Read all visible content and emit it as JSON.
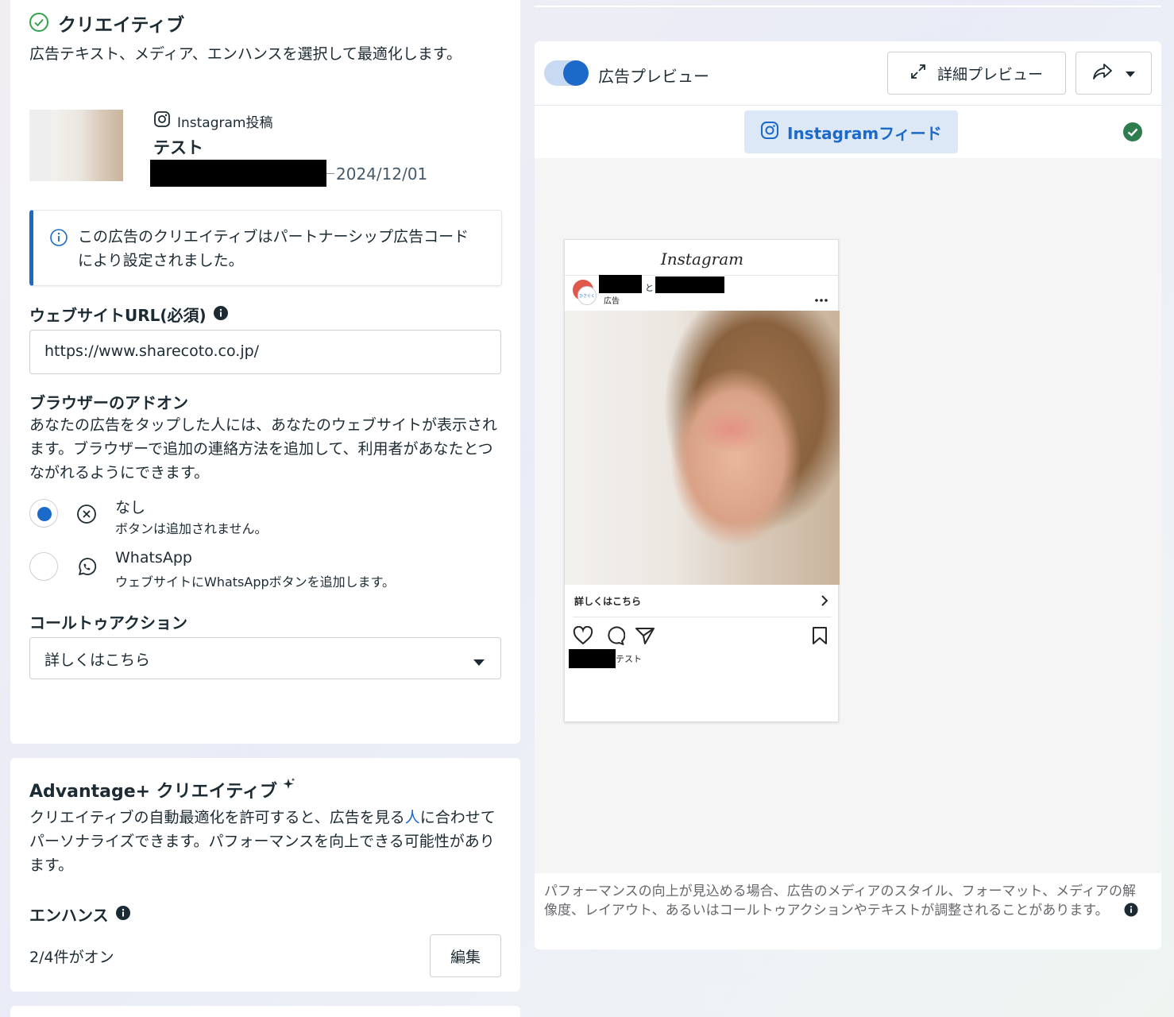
{
  "creative": {
    "title": "クリエイティブ",
    "description": "広告テキスト、メディア、エンハンスを選択して最適化します。",
    "post": {
      "platform_label": "Instagram投稿",
      "name": "テスト",
      "date": "2024/12/01"
    },
    "info_message": "この広告のクリエイティブはパートナーシップ広告コードにより設定されました。",
    "website_url": {
      "label": "ウェブサイトURL(必須)",
      "value": "https://www.sharecoto.co.jp/"
    },
    "browser_addon": {
      "title": "ブラウザーのアドオン",
      "description": "あなたの広告をタップした人には、あなたのウェブサイトが表示されます。ブラウザーで追加の連絡方法を追加して、利用者があなたとつながれるようにできます。",
      "options": [
        {
          "title": "なし",
          "subtitle": "ボタンは追加されません。",
          "selected": true,
          "icon": "x-circle-icon"
        },
        {
          "title": "WhatsApp",
          "subtitle": "ウェブサイトにWhatsAppボタンを追加します。",
          "selected": false,
          "icon": "whatsapp-icon"
        }
      ]
    },
    "cta": {
      "label": "コールトゥアクション",
      "value": "詳しくはこちら"
    }
  },
  "advantage": {
    "title": "Advantage+ クリエイティブ",
    "description_before": "クリエイティブの自動最適化を許可すると、広告を見る",
    "description_link": "人",
    "description_after": "に合わせてパーソナライズできます。パフォーマンスを向上できる可能性があります。",
    "enhance_label": "エンハンス",
    "enhance_status": "2/4件がオン",
    "edit_button": "編集"
  },
  "preview": {
    "toggle_label": "広告プレビュー",
    "toggle_on": true,
    "detail_button": "詳細プレビュー",
    "placement_tab": "Instagramフィード",
    "ig": {
      "logo": "Instagram",
      "conj": "と",
      "sponsored": "広告",
      "avatar_text": "ひさぐく",
      "cta": "詳しくはこちら",
      "caption": "テスト"
    },
    "footnote": "パフォーマンスの向上が見込める場合、広告のメディアのスタイル、フォーマット、メディアの解像度、レイアウト、あるいはコールトゥアクションやテキストが調整されることがあります。"
  },
  "colors": {
    "accent": "#1b6ac9",
    "success": "#31a24c",
    "success_dark": "#2e7d4f",
    "text": "#1c2b33"
  }
}
